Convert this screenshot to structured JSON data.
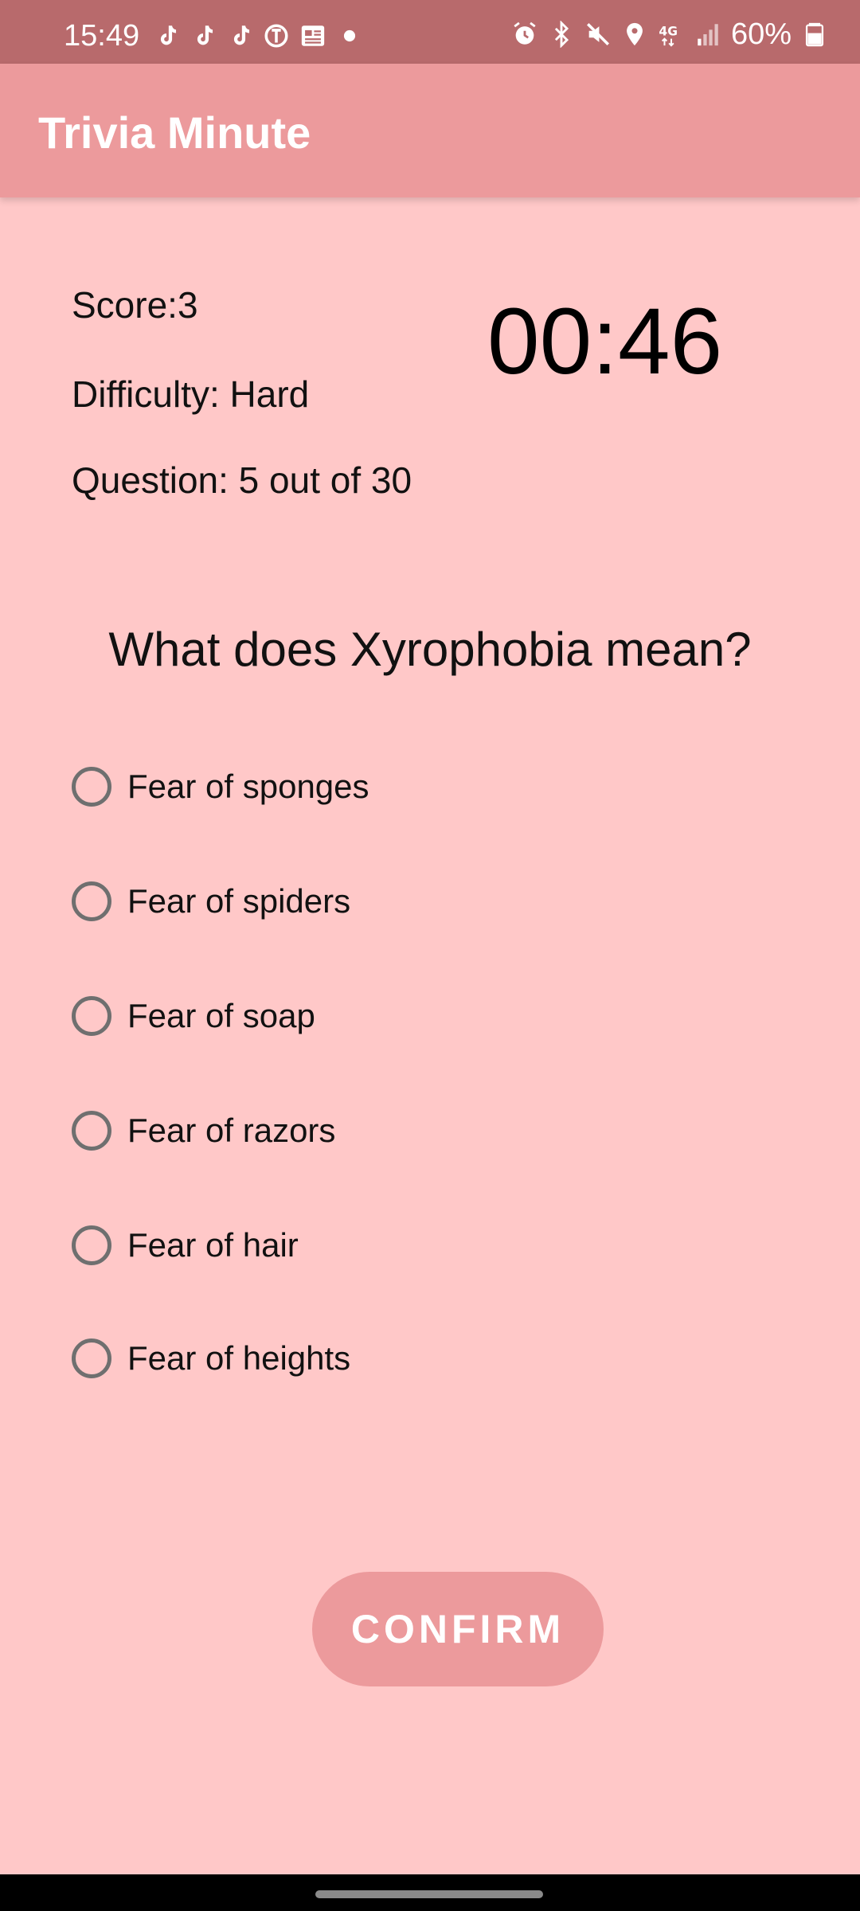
{
  "status_bar": {
    "time": "15:49",
    "battery": "60%",
    "left_icons": [
      "tiktok-icon",
      "tiktok-icon",
      "tiktok-icon",
      "nytimes-icon",
      "news-icon",
      "dot-icon"
    ],
    "right_icons": [
      "alarm-icon",
      "bluetooth-icon",
      "mute-icon",
      "location-icon",
      "4g-icon",
      "signal-icon",
      "battery-icon"
    ],
    "color": "#b86a6c"
  },
  "app_bar": {
    "title": "Trivia Minute",
    "color": "#ec9a9c"
  },
  "stats": {
    "score": "Score:3",
    "difficulty": "Difficulty: Hard",
    "question_count": "Question: 5 out of 30"
  },
  "timer": "00:46",
  "question": "What does Xyrophobia mean?",
  "options": [
    {
      "label": "Fear of sponges",
      "selected": false
    },
    {
      "label": "Fear of spiders",
      "selected": false
    },
    {
      "label": "Fear of soap",
      "selected": false
    },
    {
      "label": "Fear of razors",
      "selected": false
    },
    {
      "label": "Fear of hair",
      "selected": false
    },
    {
      "label": "Fear of heights",
      "selected": false
    }
  ],
  "confirm_label": "CONFIRM",
  "colors": {
    "background": "#ffc8c8",
    "accent": "#ec9a9c",
    "radio_border": "#6f6f6f"
  }
}
